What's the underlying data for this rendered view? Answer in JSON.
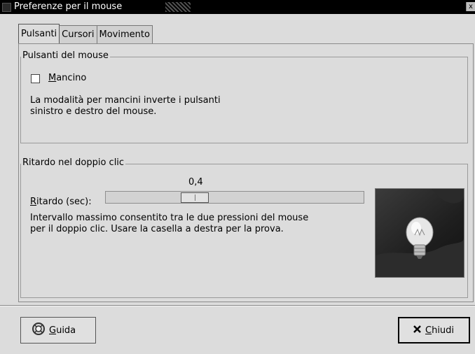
{
  "window": {
    "title": "Preferenze per il mouse",
    "close_glyph": "x"
  },
  "tabs": [
    {
      "label": "Pulsanti",
      "active": true
    },
    {
      "label": "Cursori",
      "active": false
    },
    {
      "label": "Movimento",
      "active": false
    }
  ],
  "buttons_frame": {
    "title": "Pulsanti del mouse",
    "left_handed": {
      "mnemonic": "M",
      "rest": "ancino",
      "checked": false
    },
    "description": "La modalità per mancini inverte i pulsanti\nsinistro e destro del mouse."
  },
  "double_click_frame": {
    "title": "Ritardo nel doppio clic",
    "value": "0,4",
    "slider_label": {
      "mnemonic": "R",
      "rest": "itardo (sec):"
    },
    "description": "Intervallo massimo consentito tra le due pressioni del mouse\nper il doppio clic. Usare la casella a destra per la prova.",
    "test_icon": "lightbulb-icon"
  },
  "footer": {
    "help": {
      "mnemonic": "G",
      "rest": "uida",
      "icon": "lifebuoy-icon"
    },
    "close": {
      "mnemonic": "C",
      "rest": "hiudi",
      "icon": "x-icon"
    }
  }
}
